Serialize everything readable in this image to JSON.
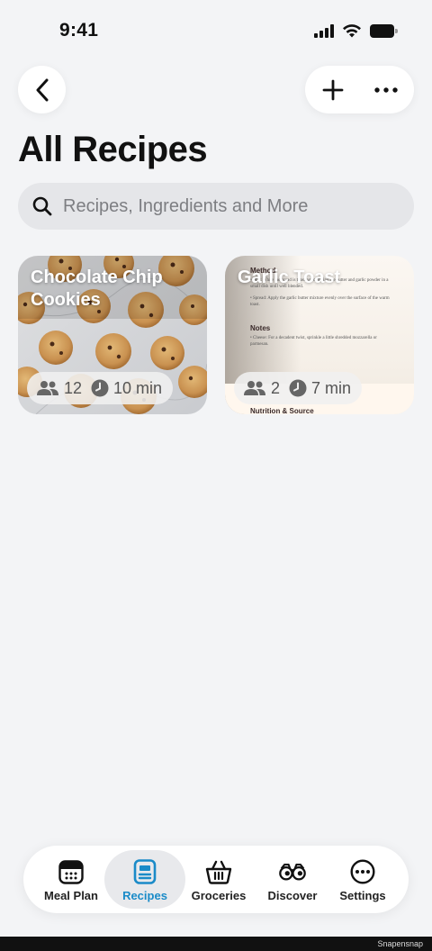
{
  "status": {
    "time": "9:41"
  },
  "header": {
    "title": "All Recipes"
  },
  "search": {
    "placeholder": "Recipes, Ingredients and More"
  },
  "recipes": [
    {
      "title": "Chocolate Chip Cookies",
      "servings": "12",
      "time": "10 min"
    },
    {
      "title": "Garlic Toast",
      "servings": "2",
      "time": "7 min"
    }
  ],
  "tabs": [
    {
      "label": "Meal Plan",
      "icon": "calendar-icon"
    },
    {
      "label": "Recipes",
      "icon": "recipe-card-icon",
      "active": true
    },
    {
      "label": "Groceries",
      "icon": "basket-icon"
    },
    {
      "label": "Discover",
      "icon": "binoculars-icon"
    },
    {
      "label": "Settings",
      "icon": "ellipsis-circle-icon"
    }
  ],
  "watermark": "Snapensnap",
  "colors": {
    "accent": "#1a8bc8",
    "background": "#f3f4f6"
  }
}
